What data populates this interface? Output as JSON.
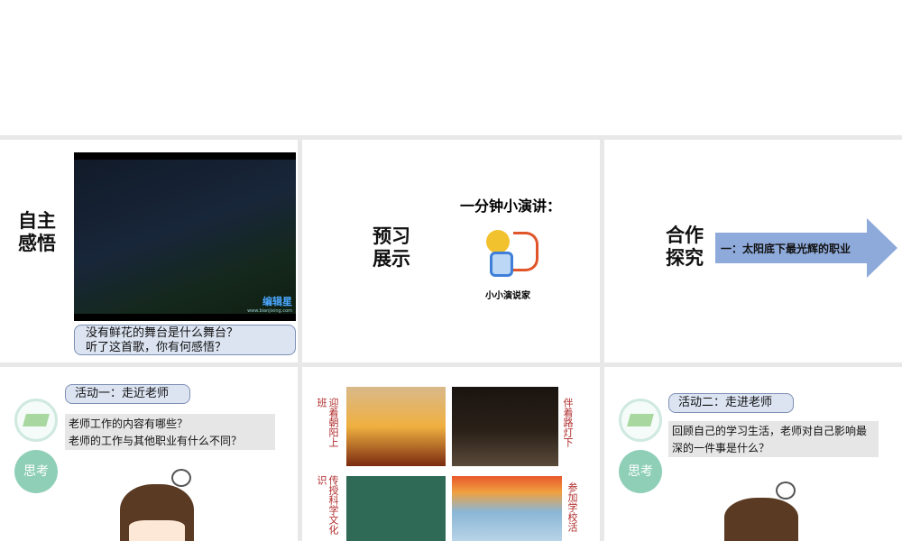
{
  "slides": [
    {
      "title": "自主感悟",
      "video_watermark": "编辑星",
      "video_url": "www.bianjixing.com",
      "question_1": "没有鲜花的舞台是什么舞台？",
      "question_2": "听了这首歌，你有何感悟？"
    },
    {
      "title": "预习展示",
      "heading": "一分钟小演讲：",
      "logo_text": "小小演说家"
    },
    {
      "title": "合作探究",
      "arrow_text": "一：太阳底下最光辉的职业"
    },
    {
      "badge": "思考",
      "activity": "活动一：走近老师",
      "question_1": "老师工作的内容有哪些？",
      "question_2": "老师的工作与其他职业有什么不同？"
    },
    {
      "captions": [
        "迎着朝阳上",
        "伴着路灯下",
        "传授科学文化",
        "参加学校活"
      ],
      "spill_left_1": "班",
      "spill_left_2": "识"
    },
    {
      "badge": "思考",
      "activity": "活动二：走进老师",
      "question": "回顾自己的学习生活，老师对自己影响最深的一件事是什么？"
    }
  ],
  "colors": {
    "arrow": "#8eaadb",
    "badge": "#8fcfb8",
    "caption": "#b02a2a"
  }
}
